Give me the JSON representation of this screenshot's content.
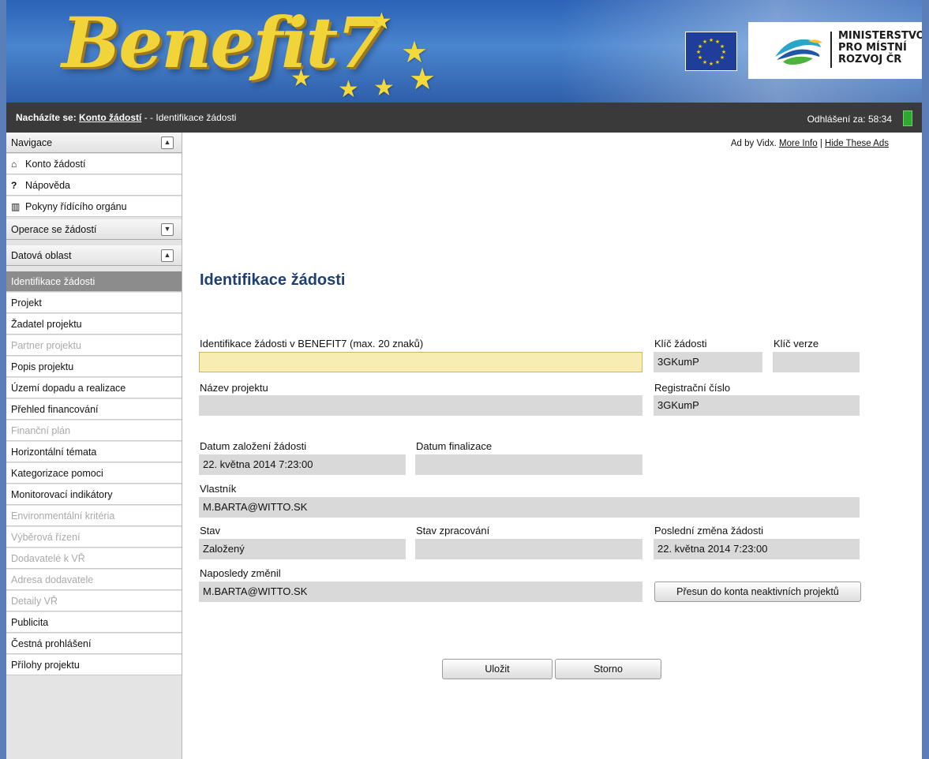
{
  "banner": {
    "logo_text": "Benefit7",
    "ministry_lines": [
      "MINISTERSTVO",
      "PRO MÍSTNÍ",
      "ROZVOJ ČR"
    ]
  },
  "status_bar": {
    "location_prefix": "Nacházíte se:",
    "location_link": "Konto žádostí",
    "location_sep": "- -",
    "location_current": "Identifikace žádosti",
    "logout_label": "Odhlášení za:",
    "logout_time": "58:34"
  },
  "sidebar": {
    "nav_header": "Navigace",
    "nav_items": [
      {
        "icon": "home-icon",
        "label": "Konto žádostí"
      },
      {
        "icon": "help-icon",
        "label": "Nápověda"
      },
      {
        "icon": "book-icon",
        "label": "Pokyny řídícího orgánu"
      }
    ],
    "operations_header": "Operace se žádostí",
    "data_header": "Datová oblast",
    "data_items": [
      {
        "label": "Identifikace žádosti",
        "state": "active"
      },
      {
        "label": "Projekt",
        "state": "enabled"
      },
      {
        "label": "Žadatel projektu",
        "state": "enabled"
      },
      {
        "label": "Partner projektu",
        "state": "disabled"
      },
      {
        "label": "Popis projektu",
        "state": "enabled"
      },
      {
        "label": "Území dopadu a realizace",
        "state": "enabled"
      },
      {
        "label": "Přehled financování",
        "state": "enabled"
      },
      {
        "label": "Finanční plán",
        "state": "disabled"
      },
      {
        "label": "Horizontální témata",
        "state": "enabled"
      },
      {
        "label": "Kategorizace pomoci",
        "state": "enabled"
      },
      {
        "label": "Monitorovací indikátory",
        "state": "enabled"
      },
      {
        "label": "Environmentální kritéria",
        "state": "disabled"
      },
      {
        "label": "Výběrová řízení",
        "state": "disabled"
      },
      {
        "label": "Dodavatelé k VŘ",
        "state": "disabled"
      },
      {
        "label": "Adresa dodavatele",
        "state": "disabled"
      },
      {
        "label": "Detaily VŘ",
        "state": "disabled"
      },
      {
        "label": "Publicita",
        "state": "enabled"
      },
      {
        "label": "Čestná prohlášení",
        "state": "enabled"
      },
      {
        "label": "Přílohy projektu",
        "state": "enabled"
      }
    ]
  },
  "ad": {
    "text": "Ad by Vidx.",
    "more_info": "More Info",
    "sep": "|",
    "hide": "Hide These Ads"
  },
  "form": {
    "title": "Identifikace žádosti",
    "id_label": "Identifikace žádosti v BENEFIT7 (max. 20 znaků)",
    "id_value": "",
    "key_label": "Klíč žádosti",
    "key_value": "3GKumP",
    "version_key_label": "Klíč verze",
    "version_key_value": "",
    "project_name_label": "Název projektu",
    "project_name_value": "",
    "reg_number_label": "Registrační číslo",
    "reg_number_value": "3GKumP",
    "created_label": "Datum založení žádosti",
    "created_value": "22. května 2014 7:23:00",
    "finalized_label": "Datum finalizace",
    "finalized_value": "",
    "owner_label": "Vlastník",
    "owner_value": "M.BARTA@WITTO.SK",
    "state_label": "Stav",
    "state_value": "Založený",
    "processing_label": "Stav zpracování",
    "processing_value": "",
    "last_change_label": "Poslední změna žádosti",
    "last_change_value": "22. května 2014 7:23:00",
    "changed_by_label": "Naposledy změnil",
    "changed_by_value": "M.BARTA@WITTO.SK",
    "move_button": "Přesun do konta neaktivních projektů"
  },
  "actions": {
    "save": "Uložit",
    "cancel": "Storno"
  },
  "colors": {
    "title_blue": "#1c3f74",
    "editable_field": "#f7edb0",
    "readonly_field": "#d9d9d9",
    "active_nav": "#8c8c8c",
    "status_bar": "#3a3a3a"
  }
}
